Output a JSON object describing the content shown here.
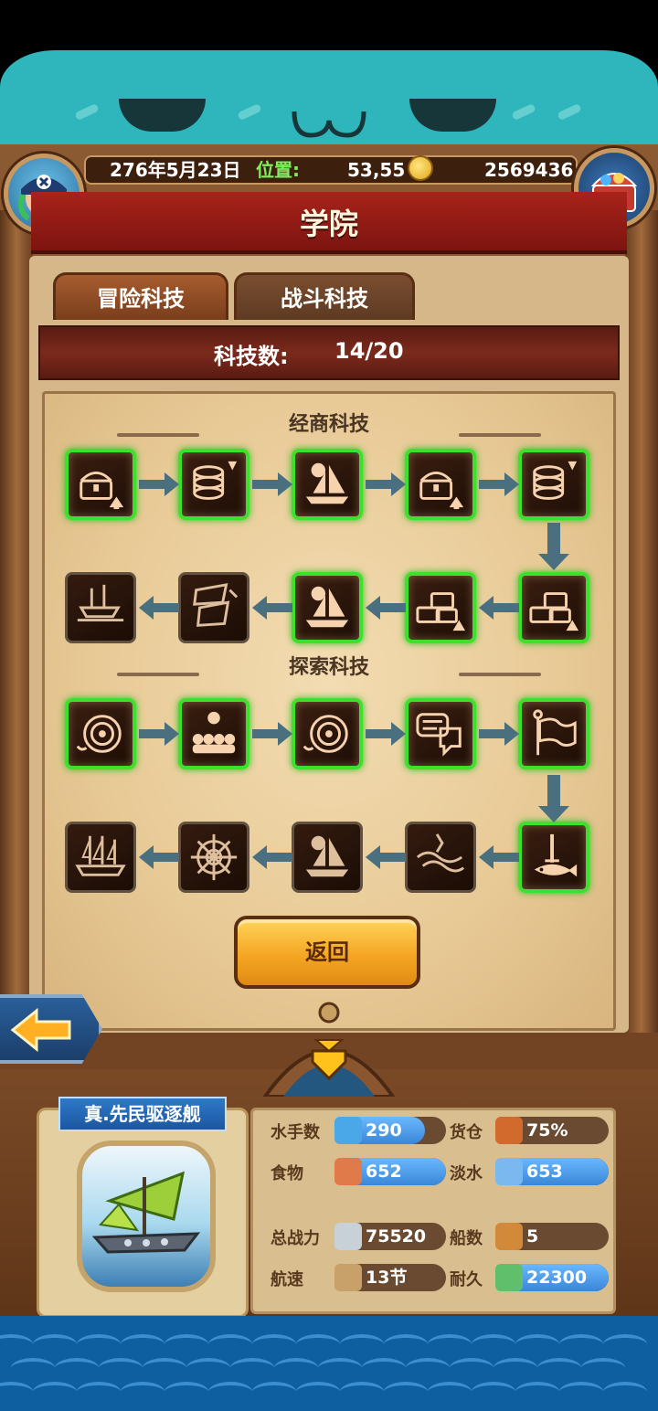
{
  "header": {
    "date": "276年5月23日",
    "position_label": "位置:",
    "position_value": "53,55",
    "gold": "2569436"
  },
  "title": "学院",
  "tabs": [
    {
      "label": "冒险科技",
      "active": true
    },
    {
      "label": "战斗科技",
      "active": false
    }
  ],
  "tech_count": {
    "label": "科技数:",
    "value": "14/20"
  },
  "sections": [
    {
      "title": "经商科技"
    },
    {
      "title": "探索科技"
    }
  ],
  "nodes": {
    "trade_row1": [
      {
        "icon": "chest-up-icon",
        "unlocked": true
      },
      {
        "icon": "coins-down-icon",
        "unlocked": true
      },
      {
        "icon": "sailboat-icon",
        "unlocked": true
      },
      {
        "icon": "chest-up-icon",
        "unlocked": true
      },
      {
        "icon": "coins-down-icon",
        "unlocked": true
      }
    ],
    "trade_row2": [
      {
        "icon": "galleon-icon",
        "unlocked": false
      },
      {
        "icon": "wreck-icon",
        "unlocked": false
      },
      {
        "icon": "sailboat-icon",
        "unlocked": true
      },
      {
        "icon": "chests-up-icon",
        "unlocked": true
      },
      {
        "icon": "chests-up-icon",
        "unlocked": true
      }
    ],
    "explore_row1": [
      {
        "icon": "compass-dial-icon",
        "unlocked": true
      },
      {
        "icon": "crew-icon",
        "unlocked": true
      },
      {
        "icon": "compass-dial-icon",
        "unlocked": true
      },
      {
        "icon": "speech-icon",
        "unlocked": true
      },
      {
        "icon": "flag-icon",
        "unlocked": true
      }
    ],
    "explore_row2": [
      {
        "icon": "ship-icon",
        "unlocked": false
      },
      {
        "icon": "helm-icon",
        "unlocked": false
      },
      {
        "icon": "sailboat-icon",
        "unlocked": false
      },
      {
        "icon": "sea-monster-icon",
        "unlocked": false
      },
      {
        "icon": "sword-fish-icon",
        "unlocked": true
      }
    ]
  },
  "return_label": "返回",
  "ship": {
    "name": "真.先民驱逐舰",
    "stats": [
      {
        "label": "水手数",
        "value": "290",
        "icon": "sailor-icon",
        "fill": 0.8
      },
      {
        "label": "货仓",
        "value": "75%",
        "icon": "crate-icon",
        "fill": 0.0
      },
      {
        "label": "食物",
        "value": "652",
        "icon": "meat-icon",
        "fill": 1.0
      },
      {
        "label": "淡水",
        "value": "653",
        "icon": "water-jug-icon",
        "fill": 1.0
      },
      {
        "label": "总战力",
        "value": "75520",
        "icon": "crossed-swords-icon",
        "fill": 0.0
      },
      {
        "label": "船数",
        "value": "5",
        "icon": "boat-icon",
        "fill": 0.0
      },
      {
        "label": "航速",
        "value": "13节",
        "icon": "speed-ship-icon",
        "fill": 0.0
      },
      {
        "label": "耐久",
        "value": "22300",
        "icon": "durability-icon",
        "fill": 1.0
      }
    ]
  },
  "colors": {
    "unlocked_border": "#3de02a",
    "title_red": "#a8231a",
    "stat_blue": "#3a86d8",
    "button_orange": "#f5a623"
  }
}
